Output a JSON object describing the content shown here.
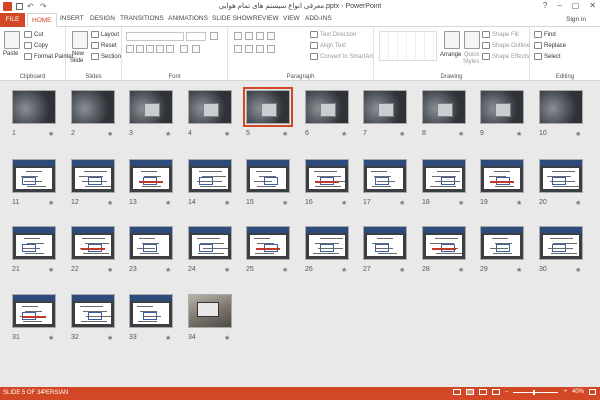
{
  "window": {
    "title": "معرفی انواع سیستم های تمام هوایی.pptx - PowerPoint",
    "minimize": "–",
    "maximize": "▢",
    "close": "✕",
    "help": "?"
  },
  "tabs": {
    "file": "FILE",
    "items": [
      "HOME",
      "INSERT",
      "DESIGN",
      "TRANSITIONS",
      "ANIMATIONS",
      "SLIDE SHOW",
      "REVIEW",
      "VIEW",
      "ADD-INS"
    ],
    "signin": "Sign in"
  },
  "ribbon": {
    "clipboard": {
      "label": "Clipboard",
      "paste": "Paste",
      "cut": "Cut",
      "copy": "Copy",
      "format_painter": "Format Painter"
    },
    "slides": {
      "label": "Slides",
      "new_slide": "New",
      "new_slide2": "Slide",
      "layout": "Layout",
      "reset": "Reset",
      "section": "Section"
    },
    "font": {
      "label": "Font"
    },
    "paragraph": {
      "label": "Paragraph",
      "text_direction": "Text Direction",
      "align_text": "Align Text",
      "convert": "Convert to SmartArt"
    },
    "drawing": {
      "label": "Drawing",
      "arrange": "Arrange",
      "quick_styles": "Quick",
      "quick_styles2": "Styles",
      "shape_fill": "Shape Fill",
      "shape_outline": "Shape Outline",
      "shape_effects": "Shape Effects"
    },
    "editing": {
      "label": "Editing",
      "find": "Find",
      "replace": "Replace",
      "select": "Select"
    }
  },
  "slides": {
    "star": "★",
    "items": [
      {
        "n": "1",
        "kind": "cover"
      },
      {
        "n": "2",
        "kind": "cover"
      },
      {
        "n": "3",
        "kind": "object"
      },
      {
        "n": "4",
        "kind": "object"
      },
      {
        "n": "5",
        "kind": "object",
        "selected": true
      },
      {
        "n": "6",
        "kind": "object"
      },
      {
        "n": "7",
        "kind": "object"
      },
      {
        "n": "8",
        "kind": "object"
      },
      {
        "n": "9",
        "kind": "object"
      },
      {
        "n": "10",
        "kind": "cover"
      },
      {
        "n": "11",
        "kind": "diagram"
      },
      {
        "n": "12",
        "kind": "diagram"
      },
      {
        "n": "13",
        "kind": "diagram"
      },
      {
        "n": "14",
        "kind": "diagram"
      },
      {
        "n": "15",
        "kind": "diagram"
      },
      {
        "n": "16",
        "kind": "diagram"
      },
      {
        "n": "17",
        "kind": "diagram"
      },
      {
        "n": "18",
        "kind": "diagram"
      },
      {
        "n": "19",
        "kind": "diagram"
      },
      {
        "n": "20",
        "kind": "diagram"
      },
      {
        "n": "21",
        "kind": "diagram"
      },
      {
        "n": "22",
        "kind": "diagram"
      },
      {
        "n": "23",
        "kind": "diagram"
      },
      {
        "n": "24",
        "kind": "diagram"
      },
      {
        "n": "25",
        "kind": "diagram"
      },
      {
        "n": "26",
        "kind": "diagram"
      },
      {
        "n": "27",
        "kind": "diagram"
      },
      {
        "n": "28",
        "kind": "diagram"
      },
      {
        "n": "29",
        "kind": "diagram"
      },
      {
        "n": "30",
        "kind": "diagram"
      },
      {
        "n": "31",
        "kind": "diagram"
      },
      {
        "n": "32",
        "kind": "diagram"
      },
      {
        "n": "33",
        "kind": "diagram"
      },
      {
        "n": "34",
        "kind": "photo"
      }
    ]
  },
  "status": {
    "slide_of": "SLIDE 5 OF 34",
    "language": "PERSIAN",
    "zoom": "40%",
    "minus": "–",
    "plus": "+"
  },
  "colors": {
    "accent": "#d24726"
  }
}
